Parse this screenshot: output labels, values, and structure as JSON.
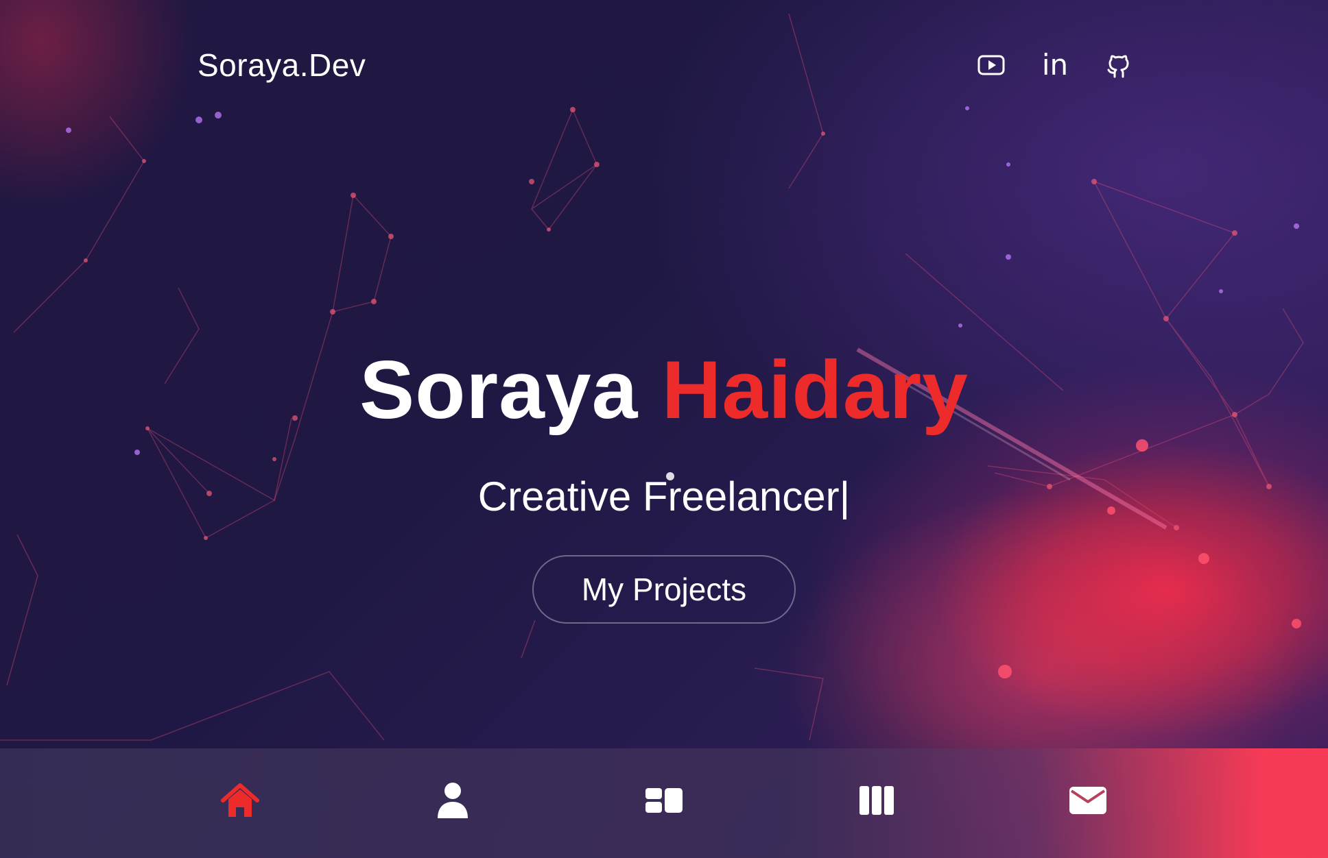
{
  "header": {
    "brand": "Soraya.Dev",
    "social": [
      {
        "icon": "youtube-icon",
        "label": "YouTube"
      },
      {
        "icon": "linkedin-icon",
        "label": "in"
      },
      {
        "icon": "github-icon",
        "label": "GitHub"
      }
    ]
  },
  "hero": {
    "first_name": "Soraya",
    "last_name": "Haidary",
    "subtitle": "Creative Freelancer|",
    "cta_label": "My Projects"
  },
  "bottom_nav": {
    "items": [
      {
        "icon": "home-icon",
        "active": true
      },
      {
        "icon": "user-icon",
        "active": false
      },
      {
        "icon": "services-icon",
        "active": false
      },
      {
        "icon": "portfolio-icon",
        "active": false
      },
      {
        "icon": "mail-icon",
        "active": false
      }
    ]
  },
  "colors": {
    "accent": "#ee2b2b",
    "background": "#211741",
    "text": "#ffffff"
  }
}
